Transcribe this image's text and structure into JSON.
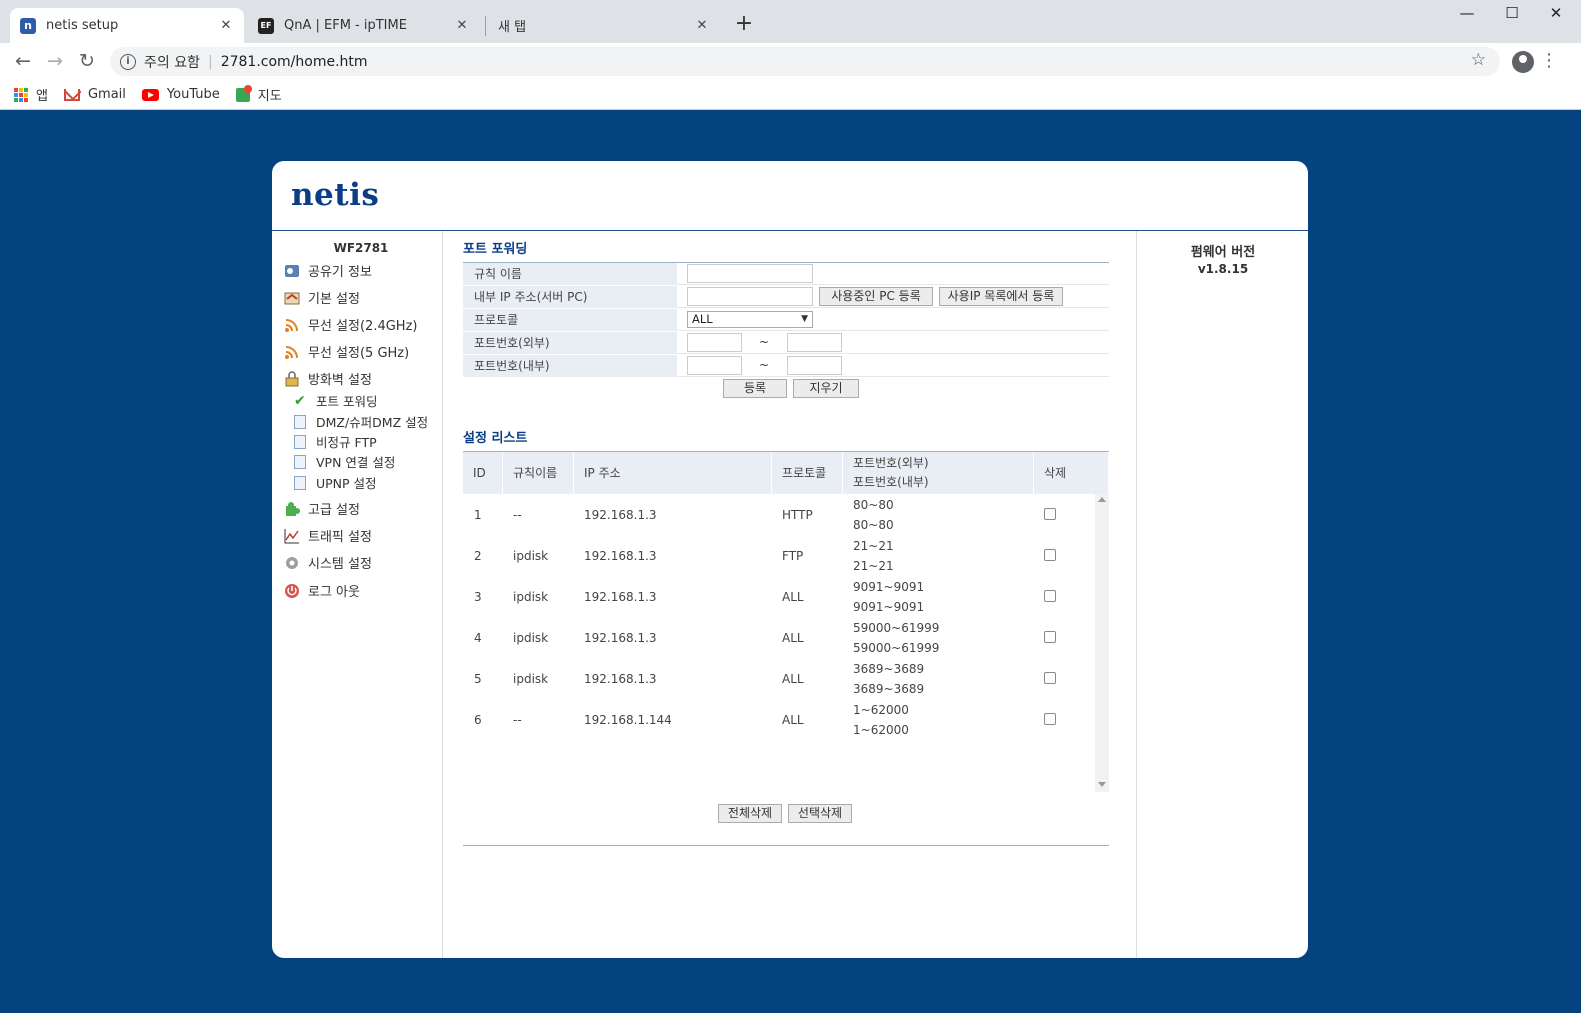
{
  "browser": {
    "tabs": [
      {
        "title": "netis setup",
        "icon": "netis-favicon",
        "active": true
      },
      {
        "title": "QnA | EFM - ipTIME",
        "icon": "efm-favicon",
        "active": false
      },
      {
        "title": "새 탭",
        "icon": "none",
        "active": false
      }
    ],
    "new_tab_label": "+",
    "address": {
      "security_label": "주의 요함",
      "url": "2781.com/home.htm"
    },
    "bookmarks": [
      {
        "label": "앱",
        "icon": "apps-grid-icon"
      },
      {
        "label": "Gmail",
        "icon": "gmail-icon"
      },
      {
        "label": "YouTube",
        "icon": "youtube-icon"
      },
      {
        "label": "지도",
        "icon": "maps-icon"
      }
    ],
    "window_controls": {
      "minimize": "—",
      "maximize": "☐",
      "close": "✕"
    }
  },
  "router": {
    "logo": "netis",
    "model": "WF2781",
    "firmware_title": "펌웨어 버전",
    "firmware_version": "v1.8.15",
    "menu": [
      {
        "label": "공유기 정보",
        "icon": "info-icon"
      },
      {
        "label": "기본 설정",
        "icon": "home-icon"
      },
      {
        "label": "무선 설정(2.4GHz)",
        "icon": "wireless-icon"
      },
      {
        "label": "무선 설정(5 GHz)",
        "icon": "wireless-icon"
      },
      {
        "label": "방화벽 설정",
        "icon": "firewall-icon"
      },
      {
        "label": "고급 설정",
        "icon": "puzzle-icon"
      },
      {
        "label": "트래픽 설정",
        "icon": "traffic-icon"
      },
      {
        "label": "시스템 설정",
        "icon": "gear-icon"
      },
      {
        "label": "로그 아웃",
        "icon": "power-icon"
      }
    ],
    "submenu": [
      {
        "label": "포트 포워딩",
        "active": true
      },
      {
        "label": "DMZ/슈퍼DMZ 설정",
        "active": false
      },
      {
        "label": "비정규 FTP",
        "active": false
      },
      {
        "label": "VPN 연결 설정",
        "active": false
      },
      {
        "label": "UPNP 설정",
        "active": false
      }
    ]
  },
  "form": {
    "title": "포트 포워딩",
    "rule_name_label": "규칙 이름",
    "rule_name_value": "",
    "internal_ip_label": "내부 IP 주소(서버 PC)",
    "internal_ip_value": "",
    "register_current_pc_button": "사용중인 PC 등록",
    "register_from_ip_list_button": "사용IP 목록에서 등록",
    "protocol_label": "프로토콜",
    "protocol_value": "ALL",
    "ext_port_label": "포트번호(외부)",
    "int_port_label": "포트번호(내부)",
    "tilde": "~",
    "submit_button": "등록",
    "clear_button": "지우기"
  },
  "list": {
    "title": "설정 리스트",
    "headers": {
      "id": "ID",
      "rule_name": "규칙이름",
      "ip": "IP 주소",
      "protocol": "프로토콜",
      "port_ext": "포트번호(외부)",
      "port_int": "포트번호(내부)",
      "delete": "삭제"
    },
    "rows": [
      {
        "id": "1",
        "name": "--",
        "ip": "192.168.1.3",
        "protocol": "HTTP",
        "ext": "80~80",
        "int": "80~80",
        "checked": false
      },
      {
        "id": "2",
        "name": "ipdisk",
        "ip": "192.168.1.3",
        "protocol": "FTP",
        "ext": "21~21",
        "int": "21~21",
        "checked": false
      },
      {
        "id": "3",
        "name": "ipdisk",
        "ip": "192.168.1.3",
        "protocol": "ALL",
        "ext": "9091~9091",
        "int": "9091~9091",
        "checked": false
      },
      {
        "id": "4",
        "name": "ipdisk",
        "ip": "192.168.1.3",
        "protocol": "ALL",
        "ext": "59000~61999",
        "int": "59000~61999",
        "checked": false
      },
      {
        "id": "5",
        "name": "ipdisk",
        "ip": "192.168.1.3",
        "protocol": "ALL",
        "ext": "3689~3689",
        "int": "3689~3689",
        "checked": false
      },
      {
        "id": "6",
        "name": "--",
        "ip": "192.168.1.144",
        "protocol": "ALL",
        "ext": "1~62000",
        "int": "1~62000",
        "checked": false
      }
    ],
    "delete_all_button": "전체삭제",
    "delete_selected_button": "선택삭제"
  },
  "colors": {
    "page_background": "#04437f",
    "brand": "#0a3d86",
    "label_background": "#e9eef4"
  }
}
